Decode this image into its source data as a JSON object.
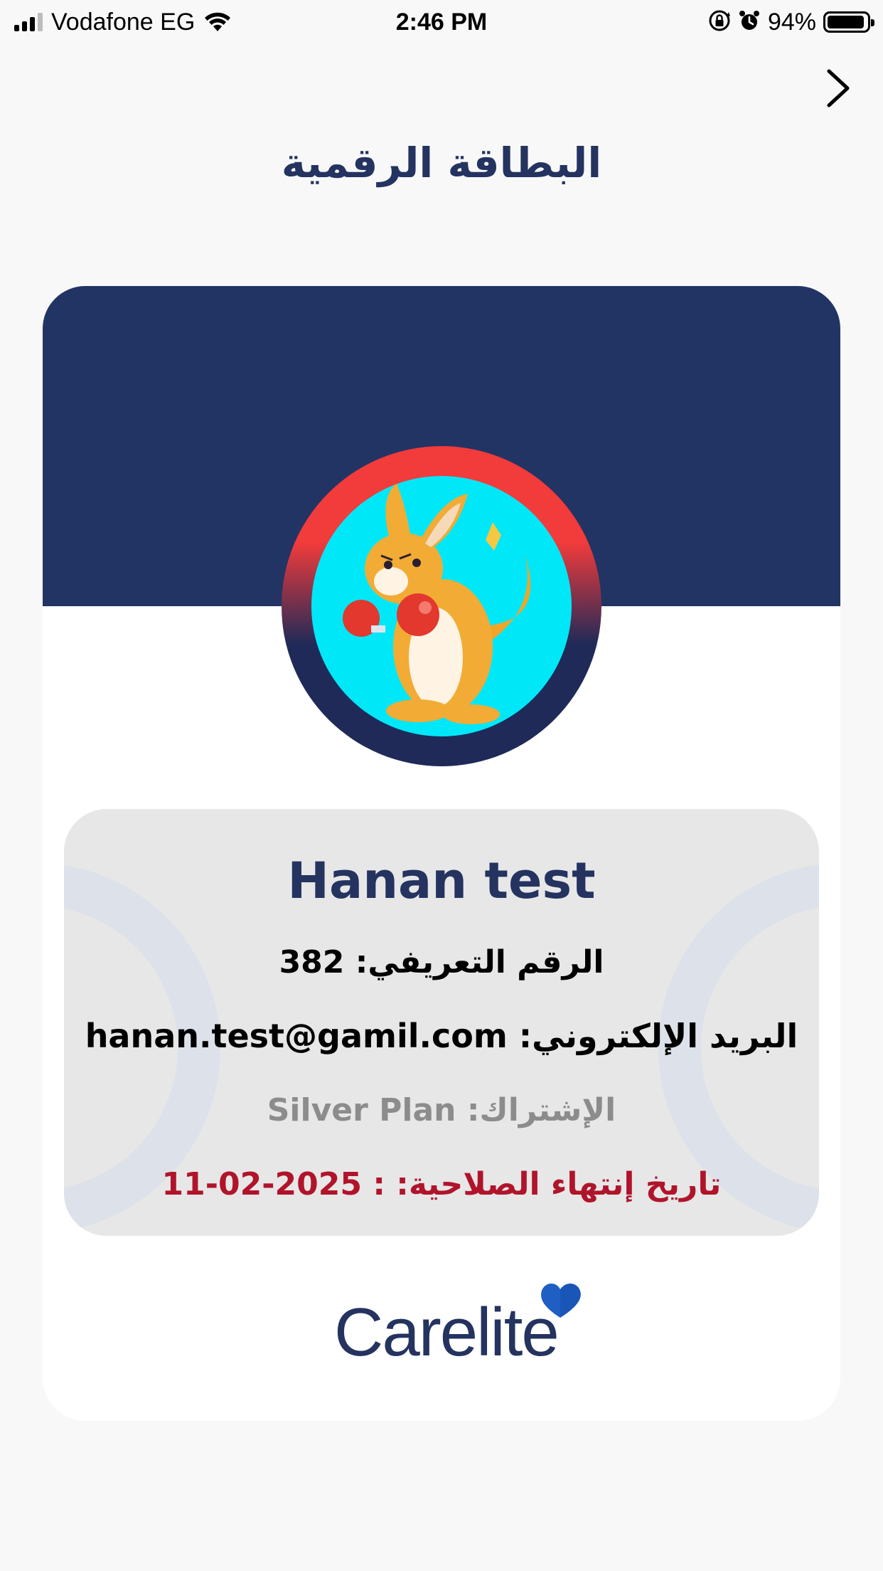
{
  "status_bar": {
    "carrier": "Vodafone EG",
    "time": "2:46 PM",
    "battery_percent": "94%",
    "signal_bars_filled": 3,
    "signal_bars_total": 4,
    "battery_level": 0.94,
    "icons": [
      "signal-icon",
      "wifi-icon",
      "orientation-lock-icon",
      "alarm-icon",
      "battery-icon"
    ]
  },
  "header": {
    "title": "البطاقة الرقمية",
    "nav_icon": "chevron-right-icon"
  },
  "card": {
    "banner_color": "#223463",
    "avatar_description_icon": "kangaroo-boxer-avatar",
    "name": "Hanan test",
    "id_label": "الرقم التعريفي:",
    "id_value": "382",
    "email_label": "البريد الإلكتروني:",
    "email_value": "hanan.test@gamil.com",
    "plan_label": "الإشتراك:",
    "plan_value": "Silver Plan",
    "expiry_label": "تاريخ إنتهاء الصلاحية: :",
    "expiry_value": "11-02-2025"
  },
  "brand": {
    "logo_text": "Carelite",
    "logo_color": "#24335f",
    "heart_color": "#1f5fc4"
  },
  "colors": {
    "title": "#24335f",
    "expiry": "#b0142b",
    "plan": "#8c8c8c",
    "avatar_ring_top": "#f23b3b",
    "avatar_bg": "#00e7f8"
  }
}
